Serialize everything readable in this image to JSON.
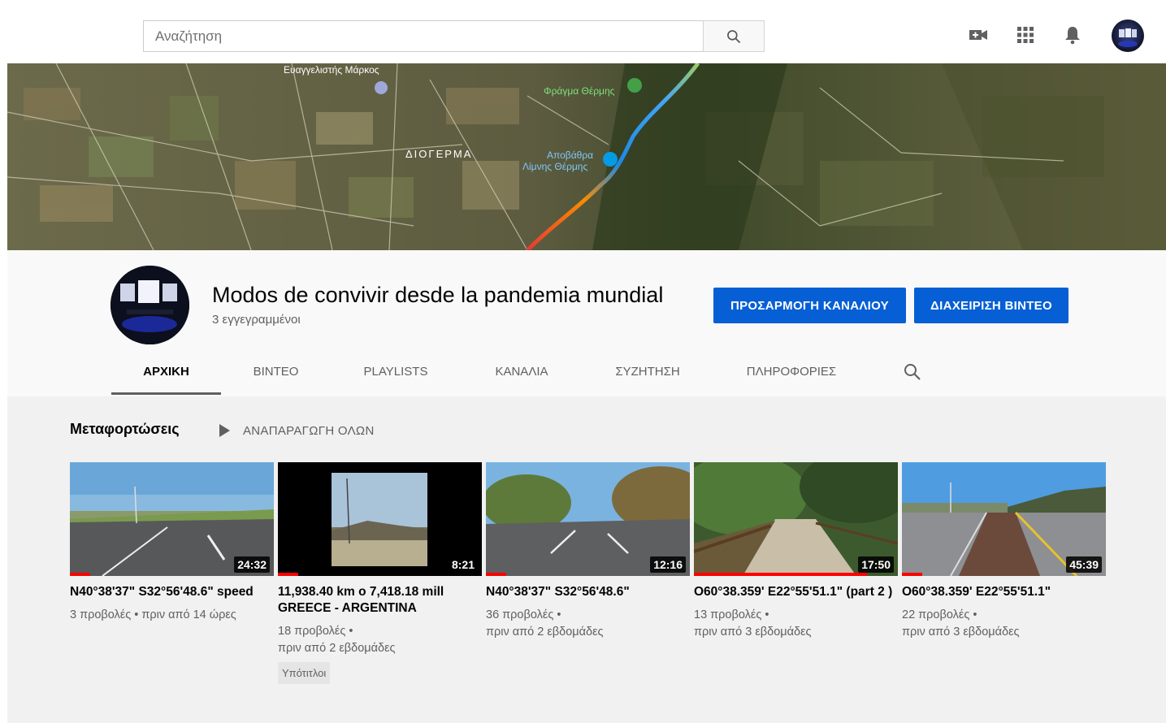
{
  "search": {
    "placeholder": "Αναζήτηση"
  },
  "header_icons": [
    "create-video-icon",
    "apps-grid-icon",
    "notifications-bell-icon",
    "account-avatar"
  ],
  "banner": {
    "labels": {
      "place1": "Ευαγγελιστής Μάρκος",
      "place2": "Φράγμα Θέρμης",
      "place3": "ΔΙΟΓΕΡΜΑ",
      "place4": "Αποβάθρα",
      "place5": "Λίμνης Θέρμης"
    }
  },
  "channel": {
    "name": "Modos de convivir desde la pandemia mundial",
    "subscribers": "3 εγγεγραμμένοι",
    "customize_label": "ΠΡΟΣΑΡΜΟΓΗ ΚΑΝΑΛΙΟΥ",
    "manage_label": "ΔΙΑΧΕΙΡΙΣΗ ΒΙΝΤΕΟ"
  },
  "tabs": [
    {
      "label": "ΑΡΧΙΚΗ",
      "active": true
    },
    {
      "label": "ΒΙΝΤΕΟ",
      "active": false
    },
    {
      "label": "PLAYLISTS",
      "active": false
    },
    {
      "label": "ΚΑΝΑΛΙΑ",
      "active": false
    },
    {
      "label": "ΣΥΖΗΤΗΣΗ",
      "active": false
    },
    {
      "label": "ΠΛΗΡΟΦΟΡΙΕΣ",
      "active": false
    }
  ],
  "shelf": {
    "title": "Μεταφορτώσεις",
    "play_all": "ΑΝΑΠΑΡΑΓΩΓΗ ΟΛΩΝ"
  },
  "videos": [
    {
      "title": "N40°38'37\" S32°56'48.6\" speed",
      "duration": "24:32",
      "meta_line1": "3 προβολές • πριν από 14 ώρες",
      "meta_line2": "",
      "watched_fraction": 0.1
    },
    {
      "title": "11,938.40 km o 7,418.18 mill GREECE - ARGENTINA",
      "duration": "8:21",
      "meta_line1": "18 προβολές •",
      "meta_line2": "πριν από 2 εβδομάδες",
      "badge": "Υπότιτλοι",
      "watched_fraction": 0.1
    },
    {
      "title": "N40°38'37\" S32°56'48.6\"",
      "duration": "12:16",
      "meta_line1": "36 προβολές •",
      "meta_line2": "πριν από 2 εβδομάδες",
      "watched_fraction": 0.1
    },
    {
      "title": "O60°38.359' E22°55'51.1\" (part 2 )",
      "duration": "17:50",
      "meta_line1": "13 προβολές •",
      "meta_line2": "πριν από 3 εβδομάδες",
      "watched_fraction": 0.85
    },
    {
      "title": "O60°38.359' E22°55'51.1\"",
      "duration": "45:39",
      "meta_line1": "22 προβολές •",
      "meta_line2": "πριν από 3 εβδομάδες",
      "watched_fraction": 0.1
    }
  ],
  "colors": {
    "accent_blue": "#065fd4",
    "progress_red": "#ff0000",
    "content_bg": "#f1f1f1"
  }
}
